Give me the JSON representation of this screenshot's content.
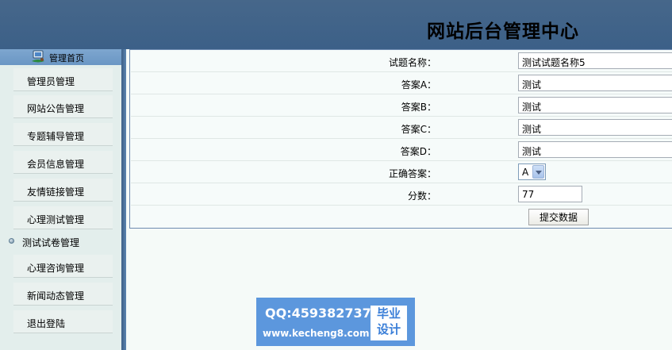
{
  "header": {
    "title": "网站后台管理中心"
  },
  "sidebar": {
    "home_label": "管理首页",
    "items": [
      {
        "label": "管理员管理"
      },
      {
        "label": "网站公告管理"
      },
      {
        "label": "专题辅导管理"
      },
      {
        "label": "会员信息管理"
      },
      {
        "label": "友情链接管理"
      },
      {
        "label": "心理测试管理"
      },
      {
        "label": "测试试卷管理",
        "active": true
      },
      {
        "label": "心理咨询管理"
      },
      {
        "label": "新闻动态管理"
      },
      {
        "label": "退出登陆"
      }
    ]
  },
  "form": {
    "rows": [
      {
        "label": "试题名称：",
        "value": "测试试题名称5"
      },
      {
        "label": "答案A：",
        "value": "测试"
      },
      {
        "label": "答案B：",
        "value": "测试"
      },
      {
        "label": "答案C：",
        "value": "测试"
      },
      {
        "label": "答案D：",
        "value": "测试"
      },
      {
        "label": "正确答案：",
        "value": "A"
      },
      {
        "label": "分数：",
        "value": "77"
      }
    ],
    "submit_label": "提交数据"
  },
  "watermark": {
    "qq": "QQ:459382737",
    "site": "www.kecheng8.com",
    "badge_line1": "毕业",
    "badge_line2": "设计"
  }
}
